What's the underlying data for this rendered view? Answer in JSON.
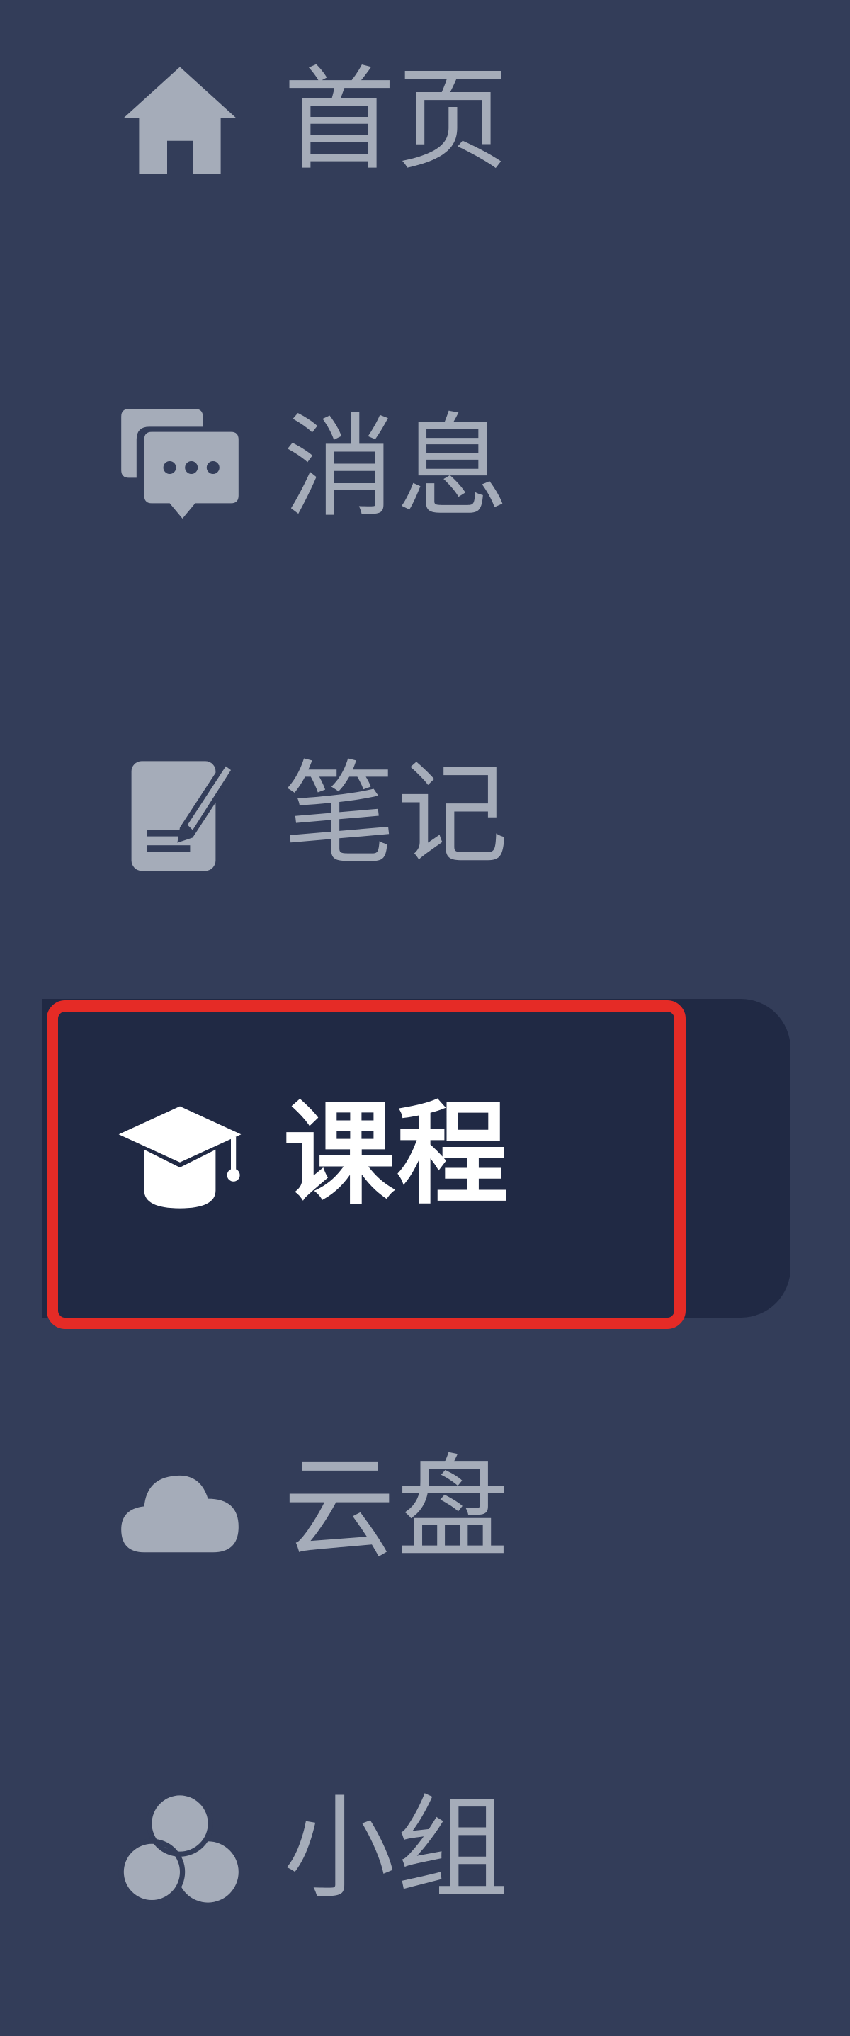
{
  "sidebar": {
    "items": [
      {
        "label": "首页",
        "icon": "home-icon",
        "active": false
      },
      {
        "label": "消息",
        "icon": "messages-icon",
        "active": false
      },
      {
        "label": "笔记",
        "icon": "notes-icon",
        "active": false
      },
      {
        "label": "课程",
        "icon": "graduation-cap-icon",
        "active": true
      },
      {
        "label": "云盘",
        "icon": "cloud-icon",
        "active": false
      },
      {
        "label": "小组",
        "icon": "group-icon",
        "active": false
      }
    ]
  },
  "colors": {
    "background": "#333d59",
    "active_background": "#202944",
    "inactive_text": "#a5acb9",
    "active_text": "#ffffff",
    "highlight_border": "#e52b26"
  }
}
